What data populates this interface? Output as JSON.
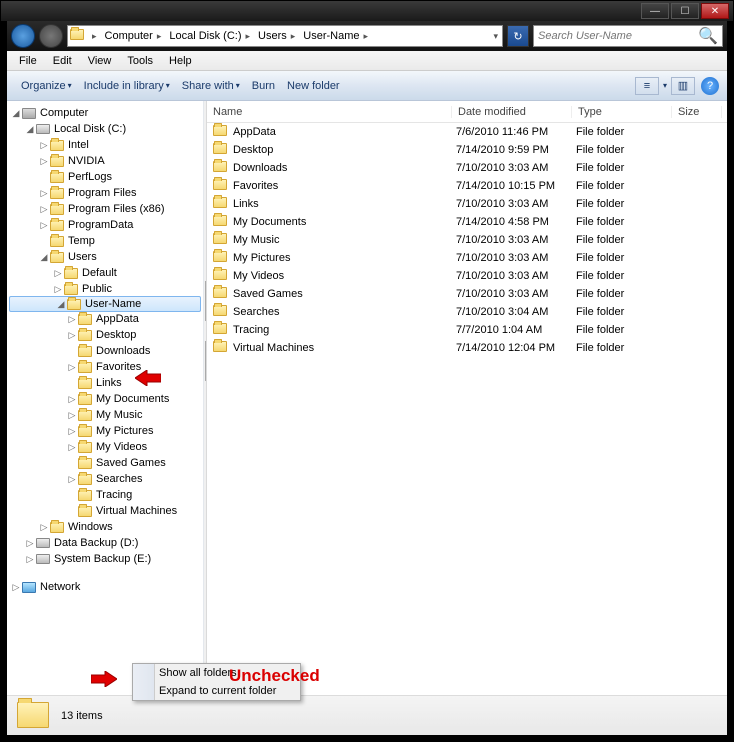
{
  "search": {
    "placeholder": "Search User-Name"
  },
  "breadcrumbs": [
    "Computer",
    "Local Disk (C:)",
    "Users",
    "User-Name"
  ],
  "menu": {
    "file": "File",
    "edit": "Edit",
    "view": "View",
    "tools": "Tools",
    "help": "Help"
  },
  "toolbar": {
    "organize": "Organize",
    "include": "Include in library",
    "share": "Share with",
    "burn": "Burn",
    "newfolder": "New folder"
  },
  "columns": {
    "name": "Name",
    "date": "Date modified",
    "type": "Type",
    "size": "Size"
  },
  "tree": {
    "computer": "Computer",
    "cdrive": "Local Disk (C:)",
    "intel": "Intel",
    "nvidia": "NVIDIA",
    "perflogs": "PerfLogs",
    "progfiles": "Program Files",
    "progfiles86": "Program Files (x86)",
    "programdata": "ProgramData",
    "temp": "Temp",
    "users": "Users",
    "default": "Default",
    "public": "Public",
    "username": "User-Name",
    "appdata": "AppData",
    "desktop": "Desktop",
    "downloads": "Downloads",
    "favorites": "Favorites",
    "links": "Links",
    "mydocs": "My Documents",
    "mymusic": "My Music",
    "mypics": "My Pictures",
    "myvids": "My Videos",
    "savedgames": "Saved Games",
    "searches": "Searches",
    "tracing": "Tracing",
    "vms": "Virtual Machines",
    "windows": "Windows",
    "ddrive": "Data Backup (D:)",
    "edrive": "System Backup (E:)",
    "network": "Network"
  },
  "files": [
    {
      "name": "AppData",
      "date": "7/6/2010 11:46 PM",
      "type": "File folder"
    },
    {
      "name": "Desktop",
      "date": "7/14/2010 9:59 PM",
      "type": "File folder"
    },
    {
      "name": "Downloads",
      "date": "7/10/2010 3:03 AM",
      "type": "File folder"
    },
    {
      "name": "Favorites",
      "date": "7/14/2010 10:15 PM",
      "type": "File folder"
    },
    {
      "name": "Links",
      "date": "7/10/2010 3:03 AM",
      "type": "File folder"
    },
    {
      "name": "My Documents",
      "date": "7/14/2010 4:58 PM",
      "type": "File folder"
    },
    {
      "name": "My Music",
      "date": "7/10/2010 3:03 AM",
      "type": "File folder"
    },
    {
      "name": "My Pictures",
      "date": "7/10/2010 3:03 AM",
      "type": "File folder"
    },
    {
      "name": "My Videos",
      "date": "7/10/2010 3:03 AM",
      "type": "File folder"
    },
    {
      "name": "Saved Games",
      "date": "7/10/2010 3:03 AM",
      "type": "File folder"
    },
    {
      "name": "Searches",
      "date": "7/10/2010 3:04 AM",
      "type": "File folder"
    },
    {
      "name": "Tracing",
      "date": "7/7/2010 1:04 AM",
      "type": "File folder"
    },
    {
      "name": "Virtual Machines",
      "date": "7/14/2010 12:04 PM",
      "type": "File folder"
    }
  ],
  "ctx": {
    "showall": "Show all folders",
    "expand": "Expand to current folder"
  },
  "status": {
    "count": "13 items"
  },
  "annot": {
    "unchecked": "Unchecked"
  }
}
